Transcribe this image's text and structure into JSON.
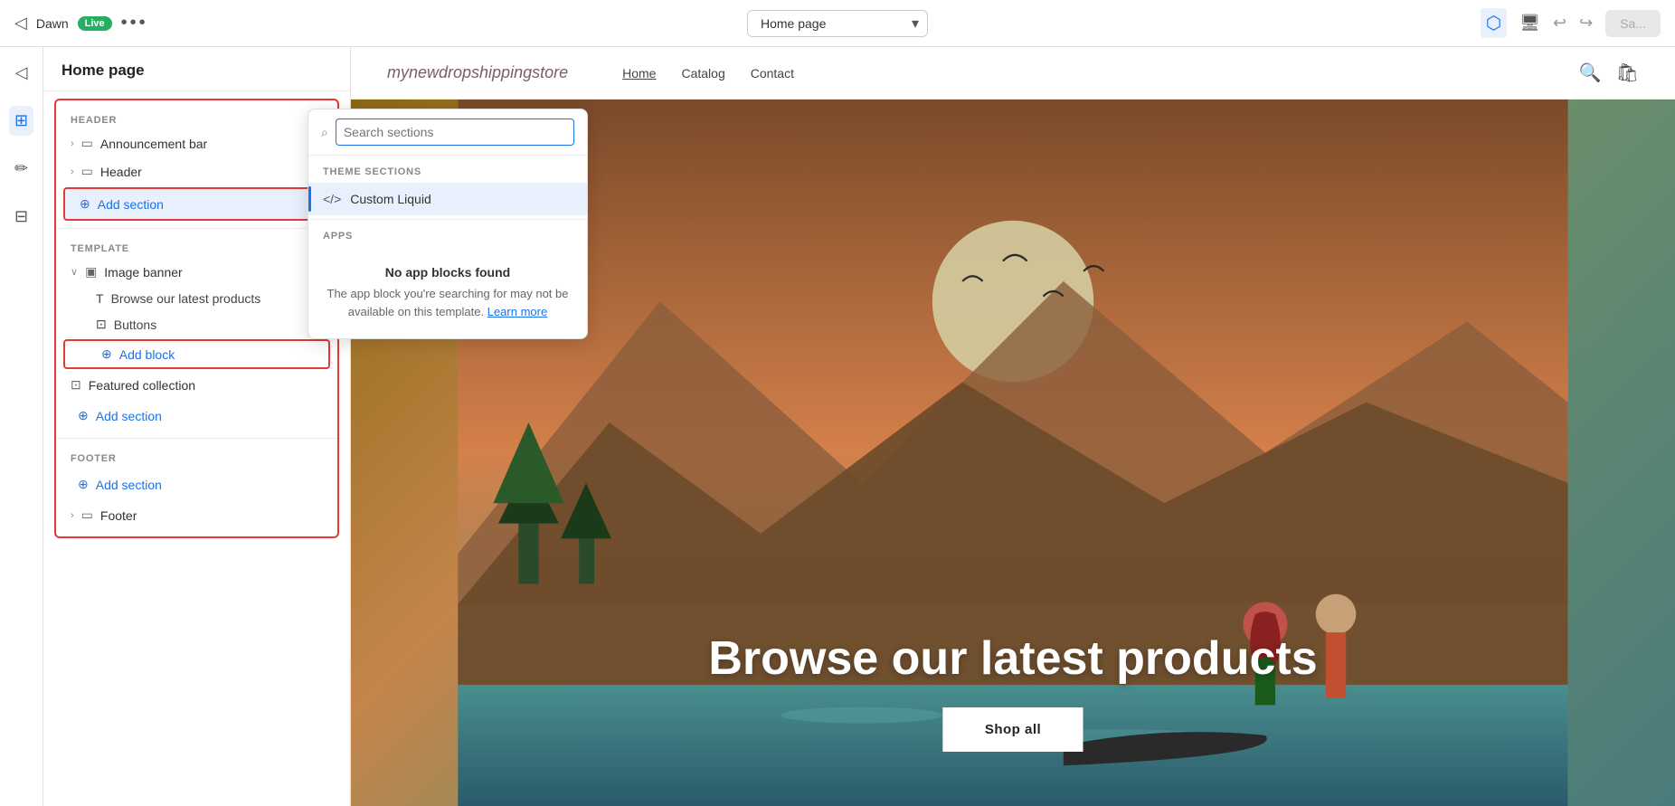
{
  "topbar": {
    "store_name": "Dawn",
    "live_label": "Live",
    "more_icon": "•••",
    "page_selector_value": "Home page",
    "save_label": "Sa..."
  },
  "sidebar": {
    "title": "Home page",
    "header_label": "HEADER",
    "template_label": "TEMPLATE",
    "footer_label": "FOOTER",
    "announcement_bar": "Announcement bar",
    "header_item": "Header",
    "image_banner": "Image banner",
    "browse_products": "Browse our latest products",
    "buttons": "Buttons",
    "add_block": "Add block",
    "featured_collection": "Featured collection",
    "add_section": "Add section",
    "footer_item": "Footer"
  },
  "search_popup": {
    "placeholder": "Search sections",
    "theme_sections_label": "THEME SECTIONS",
    "custom_liquid": "Custom Liquid",
    "apps_label": "APPS",
    "no_apps_title": "No app blocks found",
    "no_apps_desc": "The app block you're searching for may not be available on this template.",
    "learn_more": "Learn more"
  },
  "preview": {
    "store_logo": "mynewdropshippingstore",
    "nav_home": "Home",
    "nav_catalog": "Catalog",
    "nav_contact": "Contact",
    "hero_title": "Browse our latest products",
    "shop_all": "Shop all"
  },
  "icons": {
    "back": "◁",
    "layers": "⊞",
    "pencil": "✏",
    "grid": "⊟",
    "search": "⌕",
    "add": "⊕",
    "chevron_right": "›",
    "chevron_down": "∨",
    "desktop": "⬜",
    "undo": "↩",
    "redo": "↪",
    "cursor": "⬡",
    "announcement_icon": "▭",
    "header_icon": "▭",
    "image_icon": "▣",
    "text_icon": "T",
    "button_icon": "⊡",
    "collection_icon": "⊡",
    "footer_icon": "▭",
    "code_icon": "</>"
  }
}
